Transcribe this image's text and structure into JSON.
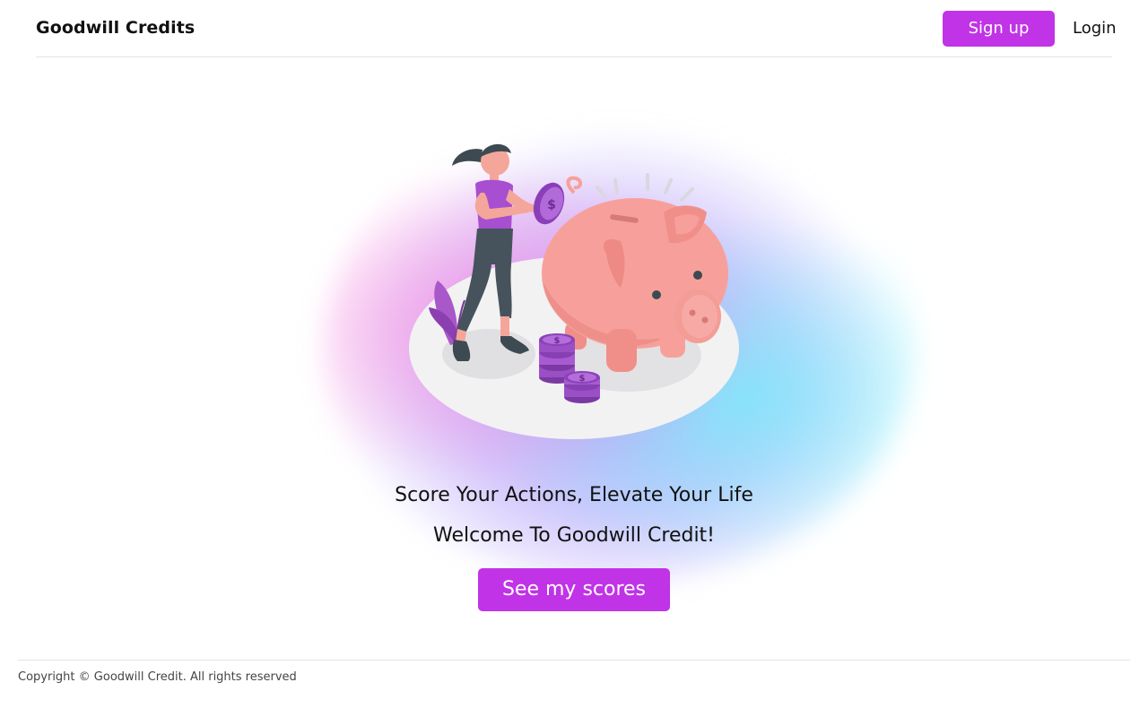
{
  "header": {
    "brand": "Goodwill Credits",
    "signup_label": "Sign up",
    "login_label": "Login"
  },
  "hero": {
    "tagline": "Score Your Actions, Elevate Your Life",
    "welcome": "Welcome To Goodwill Credit!",
    "cta_label": "See my scores",
    "illustration": "woman-saving-coins-in-piggy-bank"
  },
  "footer": {
    "copyright": "Copyright © Goodwill Credit. All rights reserved"
  },
  "colors": {
    "accent": "#c133e6",
    "text": "#111111",
    "divider": "#e3e3e3",
    "piggy": "#f7a09b",
    "coin": "#9b4fc4"
  }
}
